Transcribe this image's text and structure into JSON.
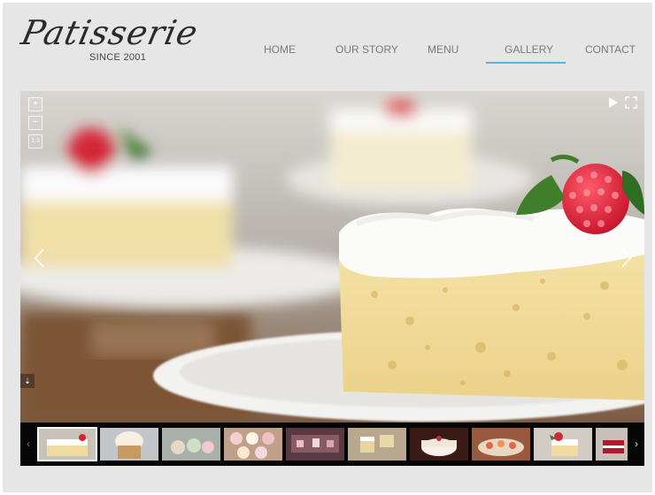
{
  "brand": {
    "name": "Patisserie",
    "tagline": "SINCE 2001"
  },
  "nav": {
    "items": [
      {
        "label": "HOME",
        "name": "nav-home"
      },
      {
        "label": "OUR STORY",
        "name": "nav-our-story"
      },
      {
        "label": "MENU",
        "name": "nav-menu"
      },
      {
        "label": "GALLERY",
        "name": "nav-gallery"
      },
      {
        "label": "CONTACT",
        "name": "nav-contact"
      }
    ],
    "active": "GALLERY",
    "accent_color": "#59b5d9"
  },
  "slideshow": {
    "subject": "slice of tres leches cake with whipped cream and raspberry on a white plate",
    "zoom_controls": {
      "in": "+",
      "out": "−",
      "fit": "1:1"
    },
    "icons": [
      "zoom-in-icon",
      "zoom-out-icon",
      "actual-size-icon",
      "play-icon",
      "fullscreen-icon",
      "prev-arrow-icon",
      "next-arrow-icon",
      "download-icon"
    ]
  },
  "thumbnails": {
    "count": 10,
    "active_index": 0,
    "items": [
      "cake-slices",
      "cupcake",
      "cupcakes-display",
      "cupcake-assortment",
      "party-table",
      "cake-slices-tray",
      "decorated-cake",
      "pastry-platter",
      "raspberry-cake-slice",
      "red-velvet"
    ]
  }
}
